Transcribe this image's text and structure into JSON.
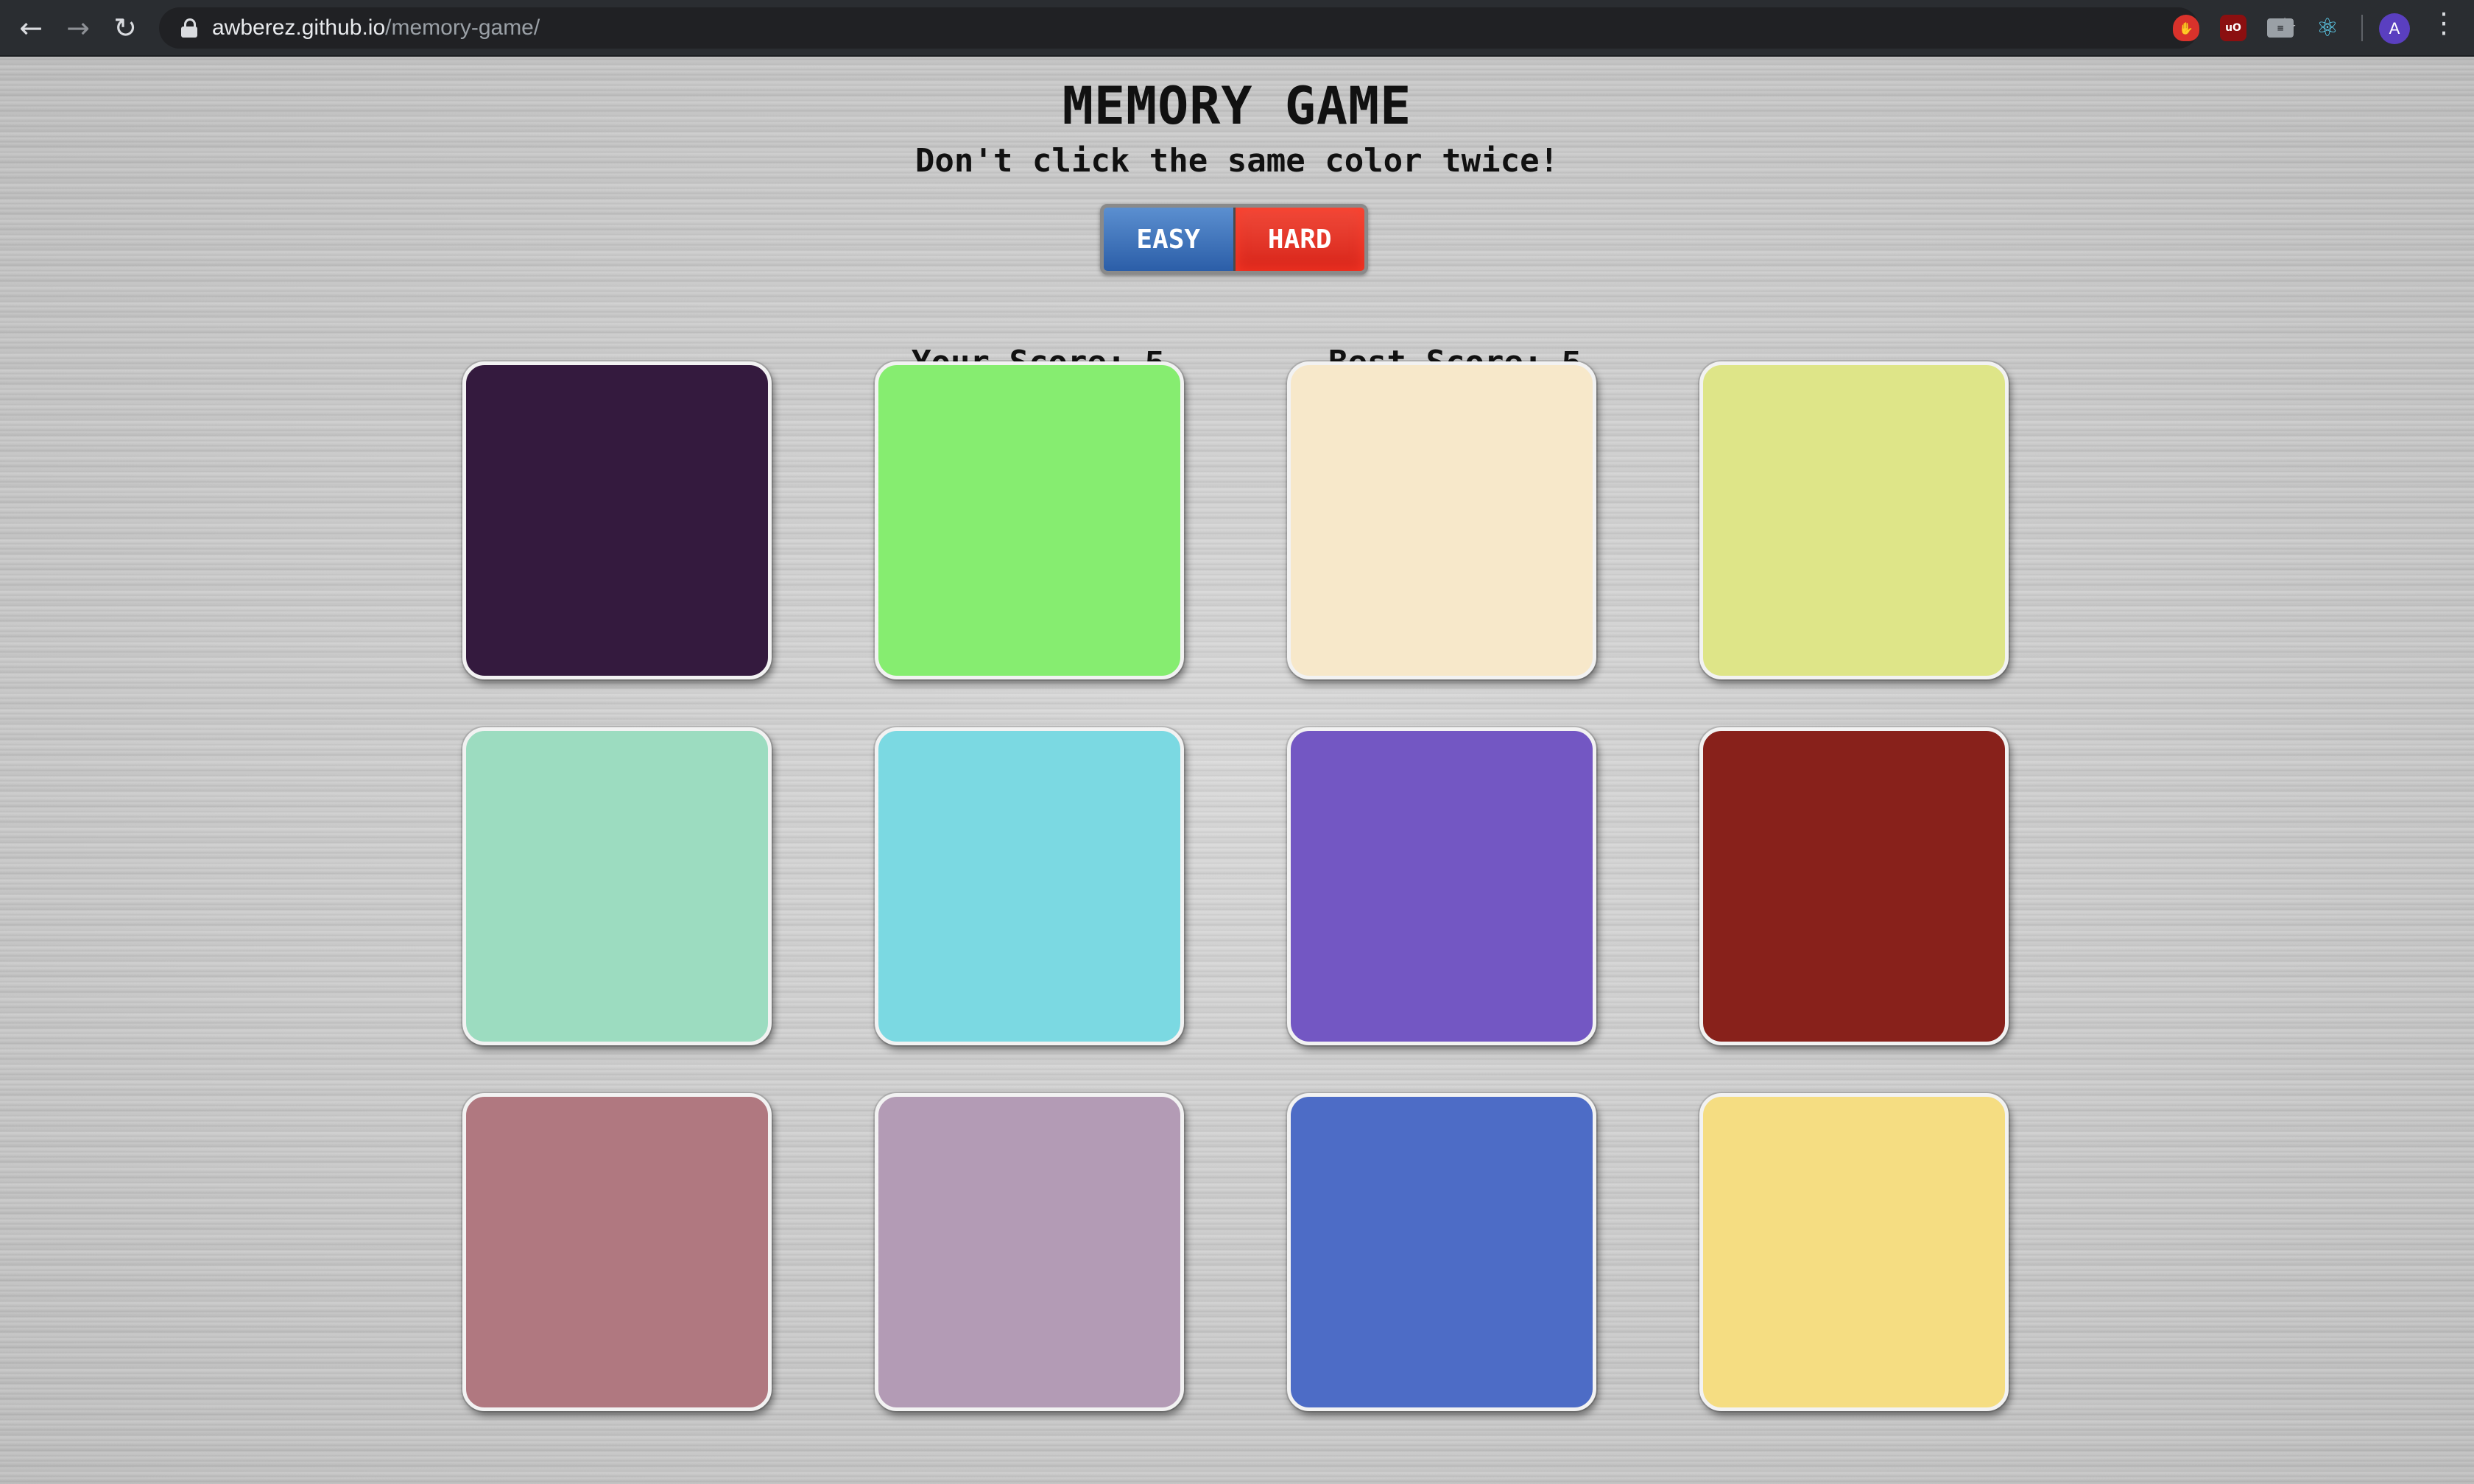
{
  "browser": {
    "back_icon": "arrow-left-icon",
    "forward_icon": "arrow-right-icon",
    "reload_icon": "reload-icon",
    "url_host": "awberez.github.io",
    "url_path": "/memory-game/",
    "avatar_initial": "A"
  },
  "game": {
    "title": "MEMORY GAME",
    "subtitle": "Don't click the same color twice!",
    "modes": {
      "easy": "EASY",
      "hard": "HARD"
    },
    "score": {
      "yours_label": "Your Score:",
      "yours_value": "5",
      "best_label": "Best Score:",
      "best_value": "5"
    },
    "cards": [
      {
        "color": "#341a3e"
      },
      {
        "color": "#86ed70"
      },
      {
        "color": "#f7e8ca"
      },
      {
        "color": "#dee588"
      },
      {
        "color": "#9cdcc0"
      },
      {
        "color": "#7bd9e2"
      },
      {
        "color": "#7357c3"
      },
      {
        "color": "#88211b"
      },
      {
        "color": "#b07880"
      },
      {
        "color": "#b39bb5"
      },
      {
        "color": "#4d6cc6"
      },
      {
        "color": "#f5dd82"
      }
    ]
  }
}
